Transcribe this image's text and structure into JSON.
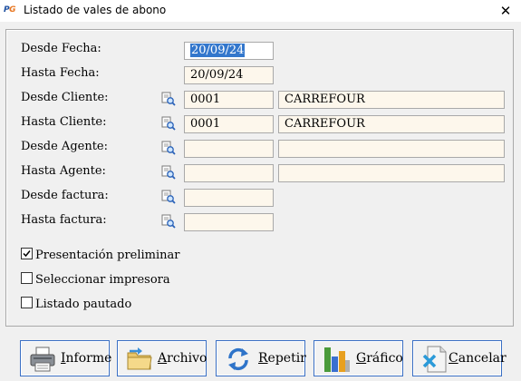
{
  "window": {
    "app_icon_text": "PG",
    "title": "Listado de vales de abono",
    "close_symbol": "✕"
  },
  "form": {
    "desde_fecha": {
      "label": "Desde Fecha:",
      "value": "20/09/24"
    },
    "hasta_fecha": {
      "label": "Hasta Fecha:",
      "value": "20/09/24"
    },
    "desde_cliente": {
      "label": "Desde Cliente:",
      "code": "0001",
      "name": "CARREFOUR"
    },
    "hasta_cliente": {
      "label": "Hasta Cliente:",
      "code": "0001",
      "name": "CARREFOUR"
    },
    "desde_agente": {
      "label": "Desde Agente:",
      "code": "",
      "name": ""
    },
    "hasta_agente": {
      "label": "Hasta Agente:",
      "code": "",
      "name": ""
    },
    "desde_factura": {
      "label": "Desde factura:",
      "value": ""
    },
    "hasta_factura": {
      "label": "Hasta factura:",
      "value": ""
    }
  },
  "options": [
    {
      "label": "Presentación preliminar",
      "checked": true
    },
    {
      "label": "Seleccionar impresora",
      "checked": false
    },
    {
      "label": "Listado pautado",
      "checked": false
    }
  ],
  "buttons": {
    "informe": {
      "first": "I",
      "rest": "nforme",
      "icon": "printer-icon"
    },
    "archivo": {
      "first": "A",
      "rest": "rchivo",
      "icon": "folder-icon"
    },
    "repetir": {
      "first": "R",
      "rest": "epetir",
      "icon": "refresh-icon"
    },
    "grafico": {
      "first": "G",
      "rest": "ráfico",
      "icon": "bar-chart-icon"
    },
    "cancelar": {
      "first": "C",
      "rest": "ancelar",
      "icon": "cancel-document-icon"
    }
  },
  "colors": {
    "field_bg": "#fdf7ec",
    "selection": "#3377cc",
    "button_border": "#3a6fc4"
  }
}
